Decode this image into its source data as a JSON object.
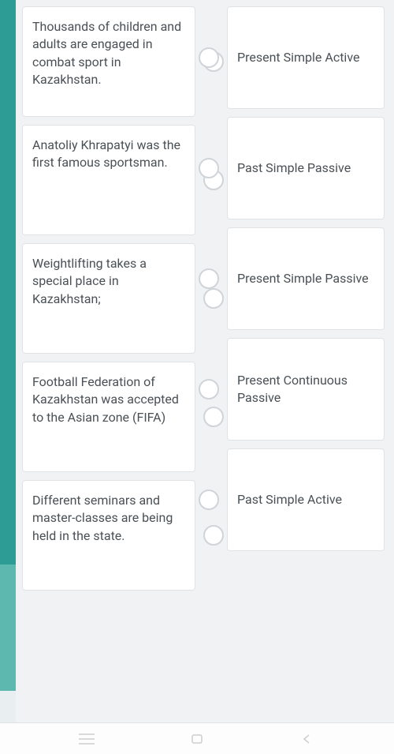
{
  "left_items": [
    "Thousands of children and adults are engaged in combat sport in Kazakhstan.",
    "Anatoliy Khrapatyi was the first famous sportsman.",
    "Weightlifting takes a special place in Kazakhstan;",
    "Football Federation of Kazakhstan was accepted to the Asian zone (FIFA)",
    "Different seminars and master-classes are being held in the state."
  ],
  "right_items": [
    "Present Simple Active",
    "Past Simple Passive",
    "Present Simple Passive",
    "Present Continuous Passive",
    "Past Simple Active"
  ]
}
